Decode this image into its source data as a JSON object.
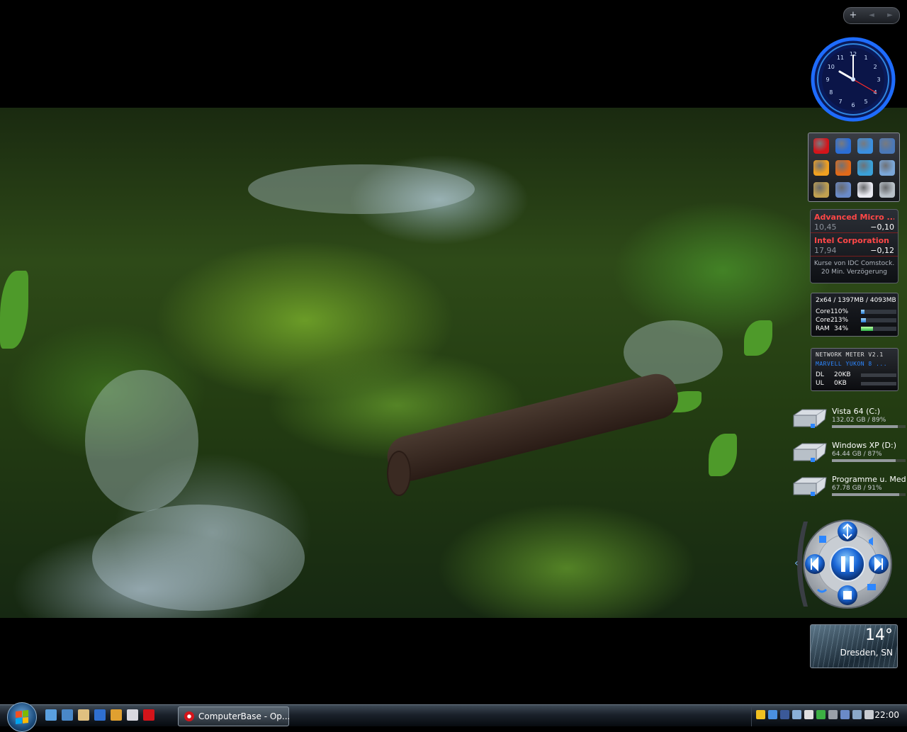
{
  "sidebar_controls": {
    "add": "+",
    "prev": "◄",
    "next": "►"
  },
  "clock": {
    "numbers": [
      "12",
      "1",
      "2",
      "3",
      "4",
      "5",
      "6",
      "7",
      "8",
      "9",
      "10",
      "11"
    ],
    "hour": 10,
    "minute": 0,
    "second": 20
  },
  "launcher": {
    "icons": [
      "opera-icon",
      "globe-icon",
      "internet-explorer-icon",
      "network-globe-icon",
      "winamp-icon",
      "media-player-icon",
      "control-panel-icon",
      "computer-icon",
      "windows-explorer-icon",
      "network-icon",
      "sidebar-gadget-icon",
      "recycle-bin-icon"
    ]
  },
  "stocks": {
    "items": [
      {
        "name": "Advanced Micro ...",
        "price": "10,45",
        "change": "−0,10"
      },
      {
        "name": "Intel Corporation",
        "price": "17,94",
        "change": "−0,12"
      }
    ],
    "note": "Kurse von IDC Comstock. 20 Min. Verzögerung"
  },
  "cpu_meter": {
    "header": "2x64 / 1397MB / 4093MB",
    "rows": [
      {
        "label": "Core1",
        "value": "10%",
        "fraction": 0.1
      },
      {
        "label": "Core2",
        "value": "13%",
        "fraction": 0.13
      },
      {
        "label": "RAM",
        "value": "34%",
        "fraction": 0.34
      }
    ]
  },
  "network_meter": {
    "title": "NETWORK METER V2.1",
    "adapter": "MARVELL YUKON 8 ...",
    "rows": [
      {
        "label": "DL",
        "value": "20KB"
      },
      {
        "label": "UL",
        "value": "0KB"
      }
    ]
  },
  "drives": [
    {
      "name": "Vista 64 (C:)",
      "size": "132.02 GB / 89%",
      "fraction": 0.89
    },
    {
      "name": "Windows XP (D:)",
      "size": "64.44 GB / 87%",
      "fraction": 0.87
    },
    {
      "name": "Programme u. Med",
      "size": "67.78 GB / 91%",
      "fraction": 0.91
    }
  ],
  "weather": {
    "temperature": "14°",
    "city": "Dresden, SN"
  },
  "taskbar": {
    "quick_launch": [
      "show-desktop-icon",
      "switch-windows-icon",
      "paint-icon",
      "firefox-icon",
      "winamp-icon",
      "folder-icon",
      "opera-icon"
    ],
    "task_button": "ComputerBase - Op...",
    "tray_icons": [
      "norton-icon",
      "network-tray-icon",
      "facebook-icon",
      "antivirus-icon",
      "amazon-icon",
      "check-icon",
      "keyboard-icon",
      "display-icon",
      "safely-remove-icon",
      "volume-icon"
    ],
    "clock": "22:00"
  },
  "colors": {
    "stock_name": "#ff4747",
    "clock_ring": "#1e6cff",
    "accent_blue": "#2c86ff"
  }
}
